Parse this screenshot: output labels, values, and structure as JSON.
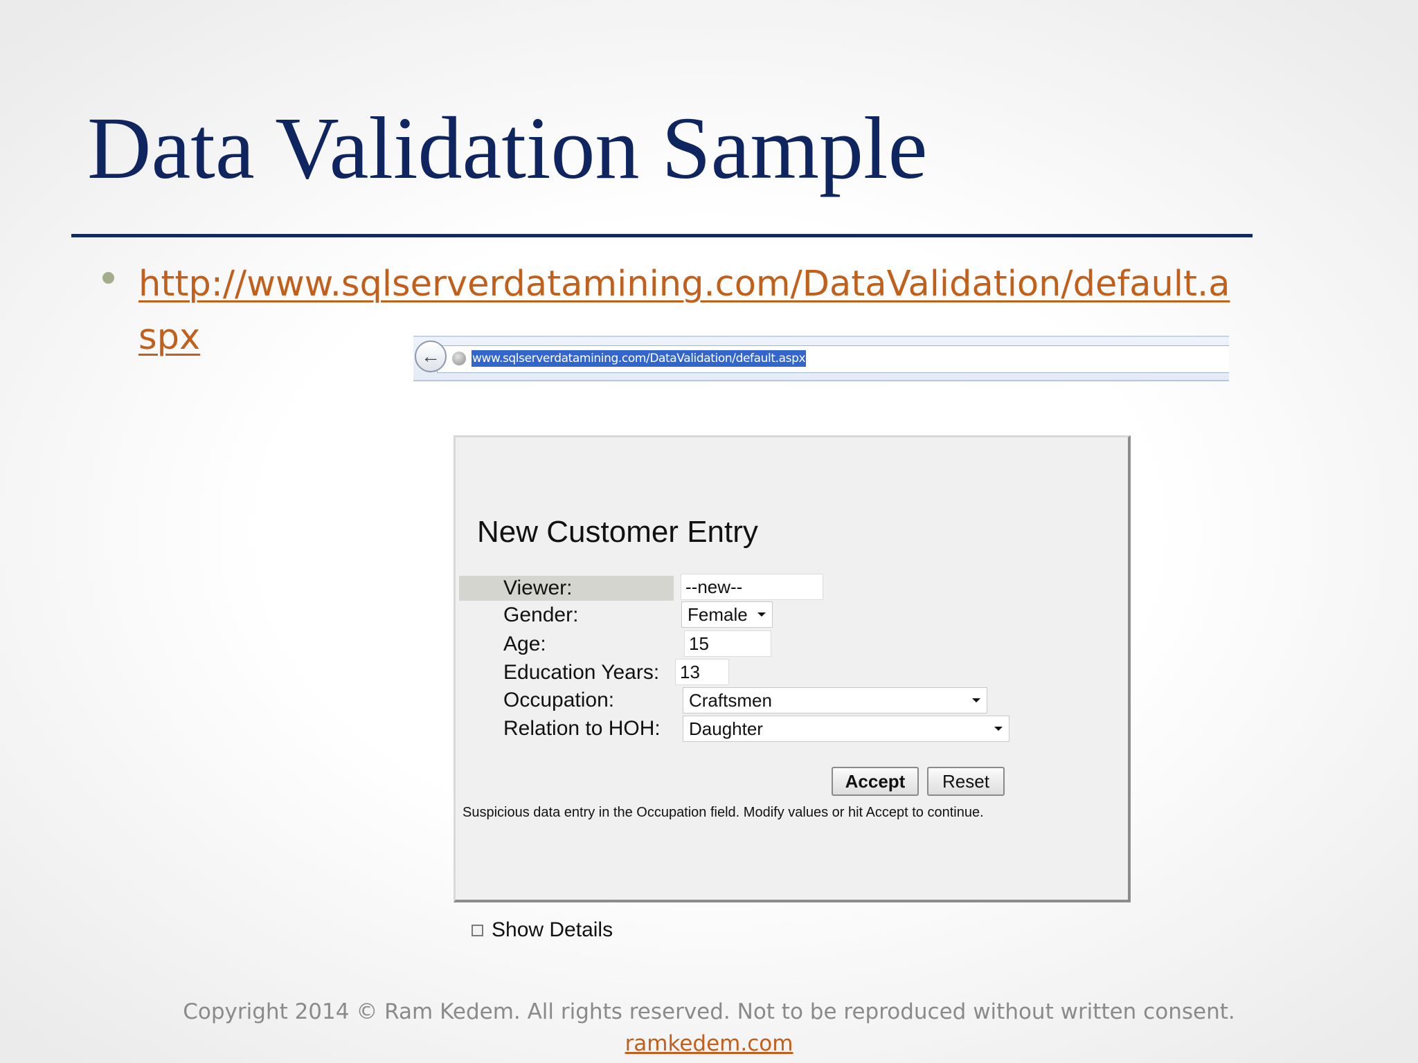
{
  "slide": {
    "title": "Data Validation Sample",
    "bullet_link": "http://www.sqlserverdatamining.com/DataValidation/default.aspx"
  },
  "browser": {
    "address": "www.sqlserverdatamining.com/DataValidation/default.aspx",
    "back_icon": "arrow-left-icon",
    "site_icon": "globe-icon"
  },
  "form": {
    "heading": "New Customer Entry",
    "fields": {
      "viewer": {
        "label": "Viewer:",
        "value": "--new--"
      },
      "gender": {
        "label": "Gender:",
        "value": "Female"
      },
      "age": {
        "label": "Age:",
        "value": "15"
      },
      "education": {
        "label": "Education Years:",
        "value": "13"
      },
      "occupation": {
        "label": "Occupation:",
        "value": "Craftsmen"
      },
      "relation": {
        "label": "Relation to HOH:",
        "value": "Daughter"
      }
    },
    "accept_label": "Accept",
    "reset_label": "Reset",
    "message": "Suspicious data entry in the Occupation field. Modify values or hit Accept to continue.",
    "show_details_label": "Show Details",
    "show_details_checked": false
  },
  "footer": {
    "copyright": "Copyright 2014 © Ram Kedem. All rights reserved. Not to be reproduced without written consent.",
    "site": "ramkedem.com"
  },
  "colors": {
    "title": "#0e2560",
    "link": "#c25f1b",
    "rule": "#142a5e",
    "selection": "#3366cc"
  }
}
